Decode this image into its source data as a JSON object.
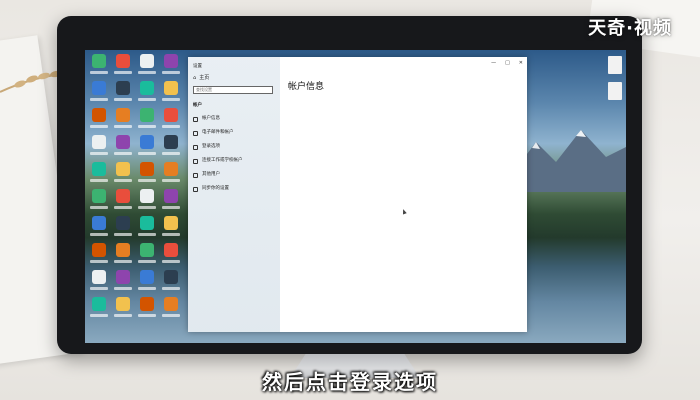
{
  "watermark": "天奇·视频",
  "caption": "然后点击登录选项",
  "settings_window": {
    "title": "设置",
    "home": "主页",
    "search_placeholder": "查找设置",
    "section": "帐户",
    "nav_items": [
      {
        "label": "帐户信息",
        "icon": "account-icon"
      },
      {
        "label": "电子邮件和帐户",
        "icon": "email-icon"
      },
      {
        "label": "登录选项",
        "icon": "key-icon"
      },
      {
        "label": "连接工作或学校帐户",
        "icon": "briefcase-icon"
      },
      {
        "label": "其他用户",
        "icon": "user-add-icon"
      },
      {
        "label": "同步你的设置",
        "icon": "sync-icon"
      }
    ],
    "heading": "帐户信息",
    "controls": {
      "minimize": "—",
      "maximize": "□",
      "close": "✕"
    }
  },
  "colors": {
    "accent": "#0078d4",
    "caption": "#ffffff"
  }
}
